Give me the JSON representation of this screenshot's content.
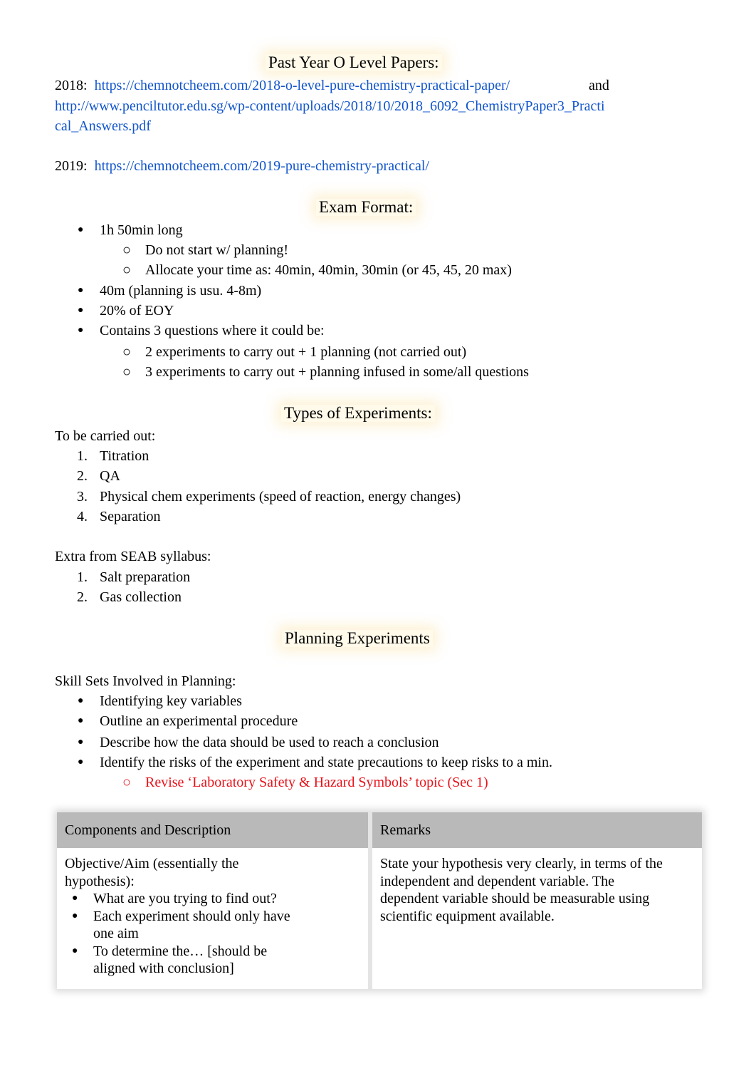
{
  "past_papers": {
    "heading": "Past Year O Level Papers:",
    "y2018_label": "2018:",
    "y2018_link1": "https://chemnotcheem.com/2018-o-level-pure-chemistry-practical-paper/",
    "and": "and",
    "y2018_link2_line1": "http://www.penciltutor.edu.sg/wp-content/uploads/2018/10/2018_6092_ChemistryPaper3_Practi",
    "y2018_link2_line2": "cal_Answers.pdf",
    "y2019_label": "2019:",
    "y2019_link": "https://chemnotcheem.com/2019-pure-chemistry-practical/"
  },
  "exam_format": {
    "heading": "Exam Format:",
    "items": [
      {
        "level": 1,
        "text": "1h 50min long"
      },
      {
        "level": 2,
        "text": "Do not start w/ planning!"
      },
      {
        "level": 2,
        "text": "Allocate your time as: 40min, 40min, 30min (or 45, 45, 20 max)"
      },
      {
        "level": 1,
        "text": "40m (planning is usu. 4-8m)"
      },
      {
        "level": 1,
        "text": "20% of EOY"
      },
      {
        "level": 1,
        "text": "Contains 3 questions where it could be:"
      },
      {
        "level": 2,
        "text": "2 experiments to carry out + 1 planning (not carried out)"
      },
      {
        "level": 2,
        "text": "3 experiments to carry out + planning infused in some/all questions"
      }
    ]
  },
  "types": {
    "heading": "Types of Experiments:",
    "carried_label": "To be carried out:",
    "carried": [
      "Titration",
      "QA",
      "Physical chem experiments (speed of reaction, energy changes)",
      "Separation"
    ],
    "extra_label": "Extra from SEAB syllabus:",
    "extra": [
      "Salt preparation",
      "Gas collection"
    ]
  },
  "planning": {
    "heading": "Planning Experiments",
    "skills_label": "Skill Sets Involved in Planning:",
    "skills": [
      "Identifying key variables",
      "Outline an experimental procedure",
      "Describe how the data should be used to reach a conclusion",
      "Identify the risks of the experiment and state precautions to keep risks to a min."
    ],
    "revise": "Revise ‘Laboratory Safety & Hazard Symbols’ topic (Sec 1)",
    "revise_color": "#e8121a"
  },
  "table": {
    "headers": [
      "Components and Description",
      "Remarks"
    ],
    "row1": {
      "component": "Objective/Aim (essentially the hypothesis):",
      "bullets": [
        "What are you trying to find out?",
        "Each experiment should only have one aim",
        "To determine the… [should be aligned with conclusion]"
      ],
      "remarks": "State your hypothesis very clearly, in terms of the independent and dependent variable. The dependent variable should be measurable using scientific equipment available."
    }
  }
}
